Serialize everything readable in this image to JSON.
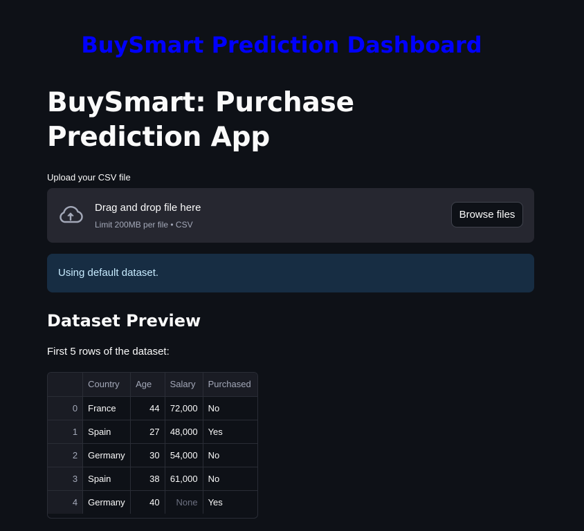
{
  "banner": {
    "title": "BuySmart Prediction Dashboard",
    "color": "#0000ff"
  },
  "app": {
    "title": "BuySmart: Purchase Prediction App"
  },
  "upload": {
    "label": "Upload your CSV file",
    "dropzone_title": "Drag and drop file here",
    "dropzone_subtitle": "Limit 200MB per file • CSV",
    "browse_label": "Browse files",
    "icon": "cloud-upload-icon"
  },
  "alert": {
    "text": "Using default dataset."
  },
  "preview": {
    "heading": "Dataset Preview",
    "caption": "First 5 rows of the dataset:",
    "columns": [
      "",
      "Country",
      "Age",
      "Salary",
      "Purchased"
    ],
    "rows": [
      {
        "index": "0",
        "country": "France",
        "age": "44",
        "salary": "72,000",
        "purchased": "No"
      },
      {
        "index": "1",
        "country": "Spain",
        "age": "27",
        "salary": "48,000",
        "purchased": "Yes"
      },
      {
        "index": "2",
        "country": "Germany",
        "age": "30",
        "salary": "54,000",
        "purchased": "No"
      },
      {
        "index": "3",
        "country": "Spain",
        "age": "38",
        "salary": "61,000",
        "purchased": "No"
      },
      {
        "index": "4",
        "country": "Germany",
        "age": "40",
        "salary": "None",
        "purchased": "Yes"
      }
    ]
  }
}
